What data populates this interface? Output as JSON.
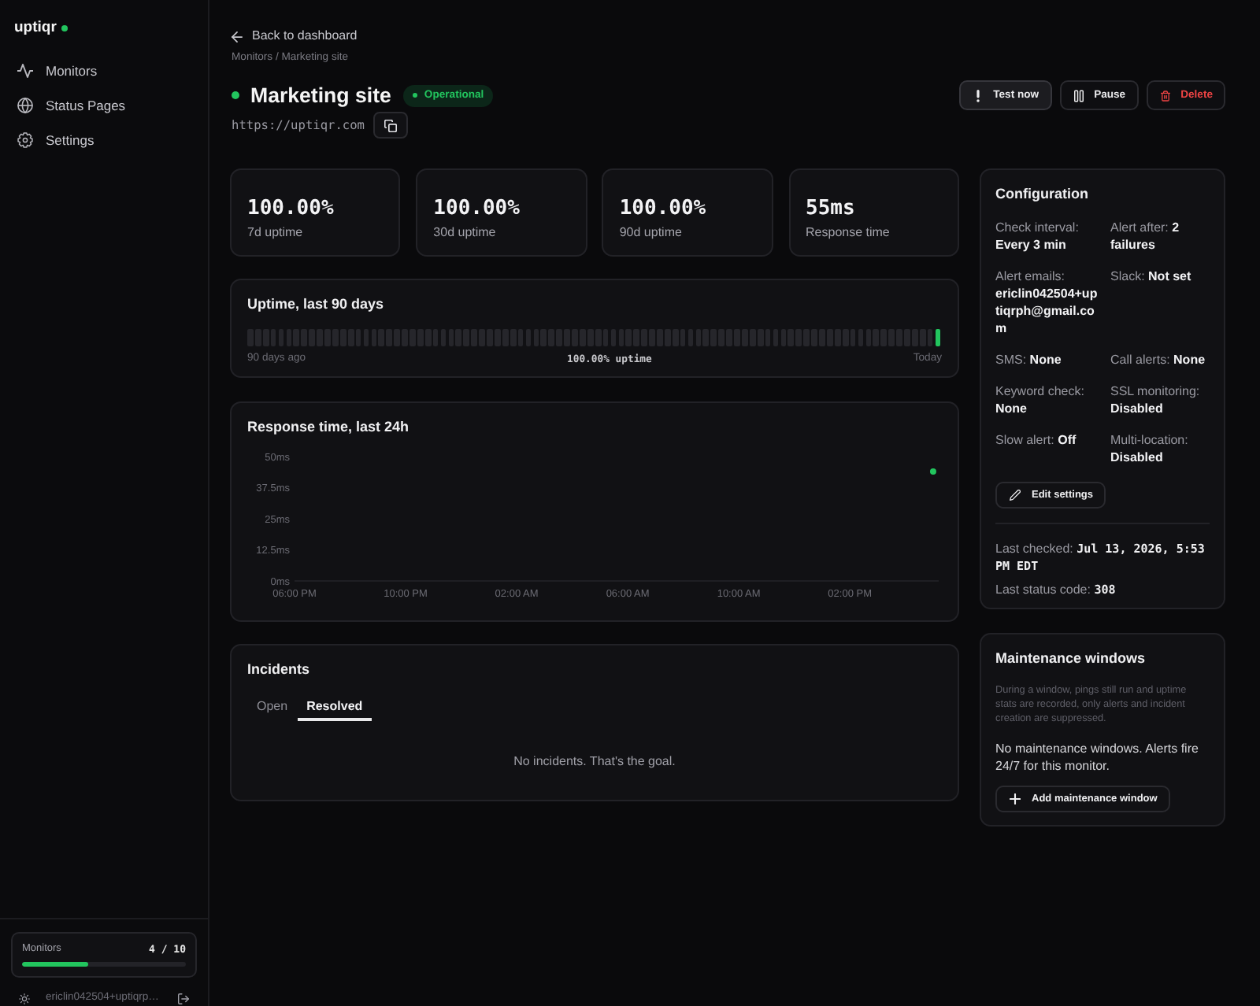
{
  "sidebar": {
    "logo": "uptiqr",
    "nav": [
      {
        "label": "Monitors"
      },
      {
        "label": "Status Pages"
      },
      {
        "label": "Settings"
      }
    ],
    "usage": {
      "label": "Monitors",
      "count": "4 / 10",
      "level": 0.4
    },
    "user": {
      "email": "ericlin042504+uptiqrp…"
    }
  },
  "header": {
    "back_link": "Back to dashboard",
    "breadcrumb": "Monitors / Marketing site",
    "title": "Marketing site",
    "status": {
      "kind": "up",
      "label": "Operational"
    },
    "url": "https://uptiqr.com",
    "actions": [
      {
        "kind": "test",
        "label": "Test now"
      },
      {
        "kind": "pause",
        "label": "Pause"
      },
      {
        "kind": "delete",
        "label": "Delete"
      }
    ]
  },
  "stats": [
    {
      "value": "100.00%",
      "label": "7d uptime"
    },
    {
      "value": "100.00%",
      "label": "30d uptime"
    },
    {
      "value": "100.00%",
      "label": "90d uptime"
    },
    {
      "value": "55ms",
      "label": "Response time"
    }
  ],
  "uptime": {
    "title": "Uptime, last 90 days",
    "days": [
      {
        "color": "#26262b"
      },
      {
        "color": "#26262b"
      },
      {
        "color": "#26262b"
      },
      {
        "color": "#26262b"
      },
      {
        "color": "#26262b"
      },
      {
        "color": "#26262b"
      },
      {
        "color": "#26262b"
      },
      {
        "color": "#26262b"
      },
      {
        "color": "#26262b"
      },
      {
        "color": "#26262b"
      },
      {
        "color": "#26262b"
      },
      {
        "color": "#26262b"
      },
      {
        "color": "#26262b"
      },
      {
        "color": "#26262b"
      },
      {
        "color": "#26262b"
      },
      {
        "color": "#26262b"
      },
      {
        "color": "#26262b"
      },
      {
        "color": "#26262b"
      },
      {
        "color": "#26262b"
      },
      {
        "color": "#26262b"
      },
      {
        "color": "#26262b"
      },
      {
        "color": "#26262b"
      },
      {
        "color": "#26262b"
      },
      {
        "color": "#26262b"
      },
      {
        "color": "#26262b"
      },
      {
        "color": "#26262b"
      },
      {
        "color": "#26262b"
      },
      {
        "color": "#26262b"
      },
      {
        "color": "#26262b"
      },
      {
        "color": "#26262b"
      },
      {
        "color": "#26262b"
      },
      {
        "color": "#26262b"
      },
      {
        "color": "#26262b"
      },
      {
        "color": "#26262b"
      },
      {
        "color": "#26262b"
      },
      {
        "color": "#26262b"
      },
      {
        "color": "#26262b"
      },
      {
        "color": "#26262b"
      },
      {
        "color": "#26262b"
      },
      {
        "color": "#26262b"
      },
      {
        "color": "#26262b"
      },
      {
        "color": "#26262b"
      },
      {
        "color": "#26262b"
      },
      {
        "color": "#26262b"
      },
      {
        "color": "#26262b"
      },
      {
        "color": "#26262b"
      },
      {
        "color": "#26262b"
      },
      {
        "color": "#26262b"
      },
      {
        "color": "#26262b"
      },
      {
        "color": "#26262b"
      },
      {
        "color": "#26262b"
      },
      {
        "color": "#26262b"
      },
      {
        "color": "#26262b"
      },
      {
        "color": "#26262b"
      },
      {
        "color": "#26262b"
      },
      {
        "color": "#26262b"
      },
      {
        "color": "#26262b"
      },
      {
        "color": "#26262b"
      },
      {
        "color": "#26262b"
      },
      {
        "color": "#26262b"
      },
      {
        "color": "#26262b"
      },
      {
        "color": "#26262b"
      },
      {
        "color": "#26262b"
      },
      {
        "color": "#26262b"
      },
      {
        "color": "#26262b"
      },
      {
        "color": "#26262b"
      },
      {
        "color": "#26262b"
      },
      {
        "color": "#26262b"
      },
      {
        "color": "#26262b"
      },
      {
        "color": "#26262b"
      },
      {
        "color": "#26262b"
      },
      {
        "color": "#26262b"
      },
      {
        "color": "#26262b"
      },
      {
        "color": "#26262b"
      },
      {
        "color": "#26262b"
      },
      {
        "color": "#26262b"
      },
      {
        "color": "#26262b"
      },
      {
        "color": "#26262b"
      },
      {
        "color": "#26262b"
      },
      {
        "color": "#26262b"
      },
      {
        "color": "#26262b"
      },
      {
        "color": "#26262b"
      },
      {
        "color": "#26262b"
      },
      {
        "color": "#26262b"
      },
      {
        "color": "#26262b"
      },
      {
        "color": "#26262b"
      },
      {
        "color": "#26262b"
      },
      {
        "color": "#26262b"
      },
      {
        "color": "#26262b"
      },
      {
        "color": "#22c55e"
      }
    ],
    "start_label": "90 days ago",
    "summary": "100.00% uptime",
    "end_label": "Today"
  },
  "response": {
    "chart_data": {
      "type": "line",
      "title": "Response time, last 24h",
      "categories": [
        "06:00 PM",
        null,
        null,
        null,
        "10:00 PM",
        null,
        null,
        null,
        "02:00 AM",
        null,
        null,
        null,
        "06:00 AM",
        null,
        null,
        null,
        "10:00 AM",
        null,
        null,
        null,
        "02:00 PM",
        null,
        null,
        null
      ],
      "series": [
        {
          "color": "#22c55e",
          "marker": "circle",
          "values": [
            null,
            null,
            null,
            null,
            null,
            null,
            null,
            null,
            null,
            null,
            null,
            null,
            null,
            null,
            null,
            null,
            null,
            null,
            null,
            null,
            null,
            null,
            null,
            44
          ]
        }
      ],
      "ylim": [
        0,
        50
      ],
      "yticks": [
        {
          "value": 0,
          "label": "0ms"
        },
        {
          "value": 12.5,
          "label": "12.5ms"
        },
        {
          "value": 25,
          "label": "25ms"
        },
        {
          "value": 37.5,
          "label": "37.5ms"
        },
        {
          "value": 50,
          "label": "50ms"
        }
      ]
    }
  },
  "incidents": {
    "title": "Incidents",
    "tabs": [
      {
        "label": "Open",
        "selected": false
      },
      {
        "label": "Resolved",
        "selected": true
      }
    ],
    "empty_text": "No incidents. That's the goal."
  },
  "configuration": {
    "title": "Configuration",
    "fields": [
      {
        "label": "Check interval:",
        "value": "Every 3 min"
      },
      {
        "label": "Alert after:",
        "value": "2 failures"
      },
      {
        "label": "Alert emails:",
        "value": "ericlin042504+uptiqrph@gmail.com"
      },
      {
        "label": "Slack:",
        "value": "Not set"
      },
      {
        "label": "SMS:",
        "value": "None"
      },
      {
        "label": "Call alerts:",
        "value": "None"
      },
      {
        "label": "Keyword check:",
        "value": "None"
      },
      {
        "label": "SSL monitoring:",
        "value": "Disabled"
      },
      {
        "label": "Slow alert:",
        "value": "Off"
      },
      {
        "label": "Multi-location:",
        "value": "Disabled"
      }
    ],
    "edit_button": "Edit settings",
    "last_checked": {
      "label": "Last checked:",
      "value": "Jul 13, 2026, 5:53 PM EDT"
    },
    "last_status": {
      "label": "Last status code:",
      "value": "308"
    }
  },
  "maintenance": {
    "title": "Maintenance windows",
    "description": "During a window, pings still run and uptime stats are recorded, only alerts and incident creation are suppressed.",
    "empty_text": "No maintenance windows. Alerts fire 24/7 for this monitor.",
    "add_button": "Add maintenance window"
  }
}
